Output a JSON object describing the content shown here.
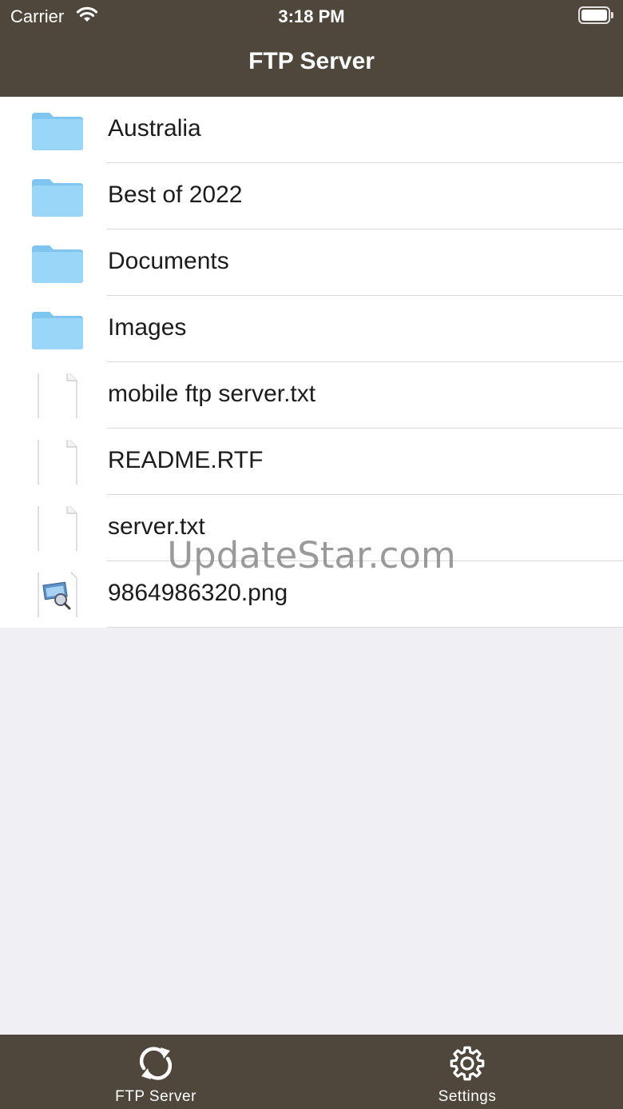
{
  "status_bar": {
    "carrier": "Carrier",
    "time": "3:18 PM"
  },
  "nav": {
    "title": "FTP Server"
  },
  "files": [
    {
      "name": "Australia",
      "kind": "folder"
    },
    {
      "name": "Best of 2022",
      "kind": "folder"
    },
    {
      "name": "Documents",
      "kind": "folder"
    },
    {
      "name": "Images",
      "kind": "folder"
    },
    {
      "name": "mobile ftp server.txt",
      "kind": "file"
    },
    {
      "name": "README.RTF",
      "kind": "file"
    },
    {
      "name": "server.txt",
      "kind": "file"
    },
    {
      "name": "9864986320.png",
      "kind": "image"
    }
  ],
  "watermark": "UpdateStar.com",
  "tabs": [
    {
      "label": "FTP Server",
      "icon": "sync-icon"
    },
    {
      "label": "Settings",
      "icon": "gear-icon"
    }
  ],
  "colors": {
    "bar_background": "#4f473b",
    "page_background": "#efeff4",
    "folder_blue": "#8fd0f5"
  }
}
